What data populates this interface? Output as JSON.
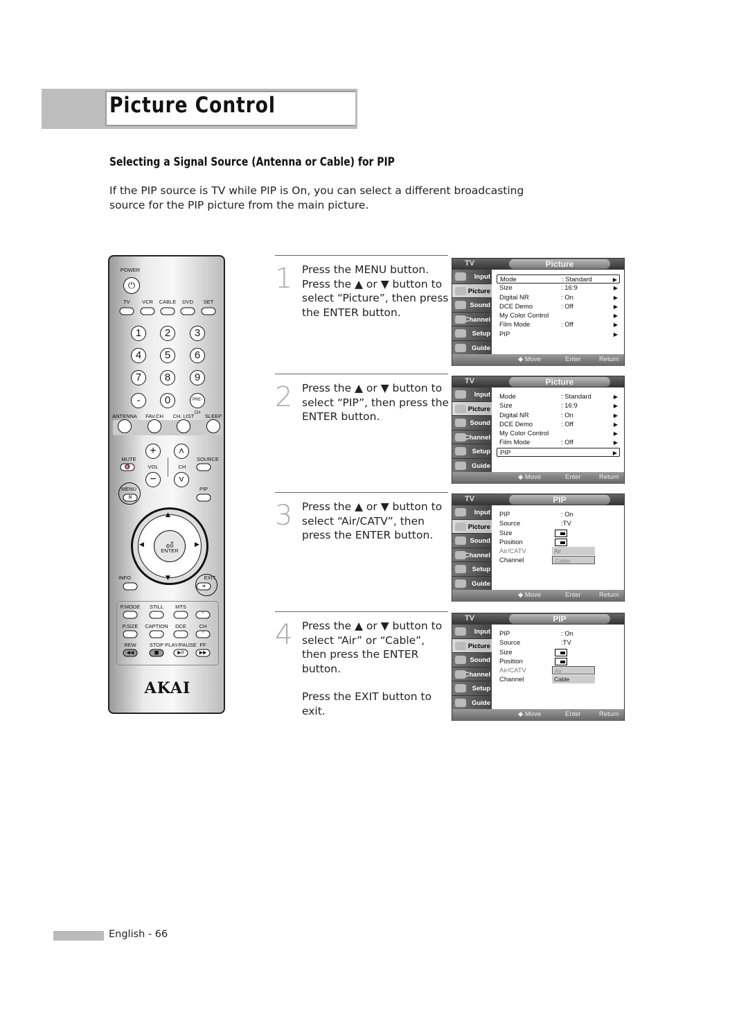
{
  "page": {
    "title": "Picture Control",
    "subtitle": "Selecting a Signal Source (Antenna or Cable) for PIP",
    "intro": "If the PIP source is TV while PIP is On, you can select a different broadcasting source for the PIP picture from the main picture.",
    "footer": "English - 66"
  },
  "steps": [
    {
      "num": "1",
      "text": "Press the MENU button. Press the ▲ or ▼ button to select “Picture”, then press the ENTER button.",
      "extra": ""
    },
    {
      "num": "2",
      "text": "Press the ▲ or ▼ button to select “PIP”, then press the ENTER button.",
      "extra": ""
    },
    {
      "num": "3",
      "text": "Press the ▲ or ▼ button to select “Air/CATV”, then press the ENTER button.",
      "extra": ""
    },
    {
      "num": "4",
      "text": "Press the ▲ or ▼ button to select “Air” or “Cable”, then press the ENTER button.",
      "extra": "Press the EXIT button to exit."
    }
  ],
  "osd_common": {
    "tv": "TV",
    "side": [
      "Input",
      "Picture",
      "Sound",
      "Channel",
      "Setup",
      "Guide"
    ],
    "active": "Picture",
    "move": "◆ Move",
    "enter": "Enter",
    "return": "Return"
  },
  "screens": [
    {
      "title": "Picture",
      "rows": [
        {
          "l": "Mode",
          "v": ": Standard",
          "ar": true,
          "sel": true
        },
        {
          "l": "Size",
          "v": ": 16:9",
          "ar": true
        },
        {
          "l": "Digital NR",
          "v": ": On",
          "ar": true
        },
        {
          "l": "DCE Demo",
          "v": ": Off",
          "ar": true
        },
        {
          "l": "My Color Control",
          "v": "",
          "ar": true
        },
        {
          "l": "Film Mode",
          "v": ": Off",
          "ar": true
        },
        {
          "l": "PIP",
          "v": "",
          "ar": true
        }
      ]
    },
    {
      "title": "Picture",
      "rows": [
        {
          "l": "Mode",
          "v": ": Standard",
          "ar": true
        },
        {
          "l": "Size",
          "v": ": 16:9",
          "ar": true
        },
        {
          "l": "Digital NR",
          "v": ": On",
          "ar": true
        },
        {
          "l": "DCE Demo",
          "v": ": Off",
          "ar": true
        },
        {
          "l": "My Color Control",
          "v": "",
          "ar": true
        },
        {
          "l": "Film Mode",
          "v": ": Off",
          "ar": true
        },
        {
          "l": "PIP",
          "v": "",
          "ar": true,
          "sel": true
        }
      ]
    },
    {
      "title": "PIP",
      "rows": [
        {
          "l": "PIP",
          "v": ": On"
        },
        {
          "l": "Source",
          "v": ":TV"
        },
        {
          "l": "Size",
          "box": true
        },
        {
          "l": "Position",
          "box": true
        },
        {
          "l": "Air/CATV",
          "dim": true,
          "opt": "Air"
        },
        {
          "l": "Channel",
          "opt": "Cable",
          "hl": true
        }
      ]
    },
    {
      "title": "PIP",
      "rows": [
        {
          "l": "PIP",
          "v": ": On"
        },
        {
          "l": "Source",
          "v": ":TV"
        },
        {
          "l": "Size",
          "box": true
        },
        {
          "l": "Position",
          "box": true
        },
        {
          "l": "Air/CATV",
          "dim": true,
          "opt": "Air",
          "hl": true
        },
        {
          "l": "Channel",
          "opt": "Cable"
        }
      ]
    }
  ],
  "remote": {
    "brand": "AKAI",
    "power": "POWER",
    "modes": [
      "TV",
      "VCR",
      "CABLE",
      "DVD",
      "SET"
    ],
    "digits": [
      "1",
      "2",
      "3",
      "4",
      "5",
      "6",
      "7",
      "8",
      "9",
      "-",
      "0",
      "PRE-CH"
    ],
    "row2": [
      "ANTENNA",
      "FAV.CH",
      "CH. LIST",
      "SLEEP"
    ],
    "mute": "MUTE",
    "vol": "VOL",
    "ch": "CH",
    "source": "SOURCE",
    "menu": "MENU",
    "pip": "PIP",
    "enter": "ENTER",
    "info": "INFO",
    "exit": "EXIT",
    "lower": [
      "P.MODE",
      "STILL",
      "MTS",
      "",
      "P.SIZE",
      "CAPTION",
      "DCE",
      "CH",
      "REW",
      "STOP",
      "PLAY/PAUSE",
      "FF"
    ]
  }
}
